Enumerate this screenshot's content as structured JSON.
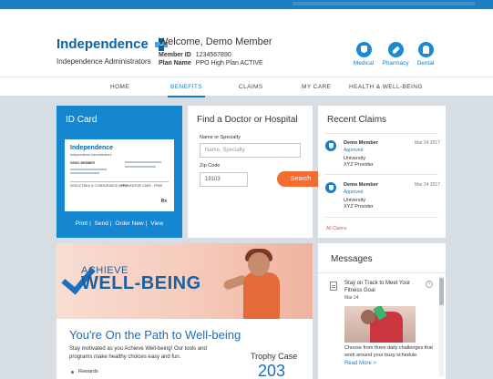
{
  "header": {
    "logo_name": "Independence",
    "logo_subtitle": "Independence Administrators",
    "welcome": "Welcome, Demo Member",
    "member_id_label": "Member ID",
    "member_id_value": "1234567890",
    "plan_name_label": "Plan Name",
    "plan_name_value": "PPO High Plan ACTIVE",
    "quick_links": [
      {
        "label": "Medical",
        "icon": "shield-icon"
      },
      {
        "label": "Pharmacy",
        "icon": "pill-icon"
      },
      {
        "label": "Dental",
        "icon": "tooth-icon"
      }
    ]
  },
  "nav": {
    "items": [
      "HOME",
      "BENEFITS",
      "CLAIMS",
      "MY CARE",
      "HEALTH & WELL-BEING"
    ],
    "active": "BENEFITS"
  },
  "id_card": {
    "title": "ID Card",
    "mini": {
      "logo": "Independence",
      "sub": "Independence Administrators",
      "member_label": "DEMO MEMBER",
      "rx_label": "Rx",
      "bottom_left": "DEDUCTIBLE & COINSURANCE APPLY",
      "bottom_right": "PREVENTIVE CARE - FREE"
    },
    "actions": [
      "Print",
      "Send",
      "Order New",
      "View"
    ]
  },
  "find_doctor": {
    "title": "Find a Doctor or Hospital",
    "name_label": "Name or Specialty",
    "name_placeholder": "Name, Specialty",
    "zip_label": "Zip Code",
    "zip_value": "19103",
    "search_label": "Search"
  },
  "recent_claims": {
    "title": "Recent Claims",
    "claims": [
      {
        "name": "Demo Member",
        "date": "Mar 24 2017",
        "status": "Approved",
        "provider_line1": "University",
        "provider_line2": "XYZ Provider"
      },
      {
        "name": "Demo Member",
        "date": "Mar 24 2017",
        "status": "Approved",
        "provider_line1": "University",
        "provider_line2": "XYZ Provider"
      }
    ],
    "all_label": "All Claims"
  },
  "wellbeing": {
    "achieve": "ACHIEVE",
    "wellbeing_word": "WELL-BEING",
    "headline": "You're On the Path to Well-being",
    "description": "Stay motivated as you Achieve Well-being! Our tools and programs make healthy choices easy and fun.",
    "list_item": "Rewards",
    "trophy_label": "Trophy Case",
    "trophy_count": "203"
  },
  "messages": {
    "title": "Messages",
    "item_title": "Stay on Track to Meet Your Fitness Goal",
    "item_date": "Mar 24",
    "item_body": "Choose from three daily challenges that work around your busy schedule.",
    "read_more": "Read More >"
  },
  "colors": {
    "brand_blue": "#1b7cc4",
    "id_card_blue": "#1586d0",
    "search_orange": "#f36b2f",
    "page_bg": "#d6dde3"
  }
}
